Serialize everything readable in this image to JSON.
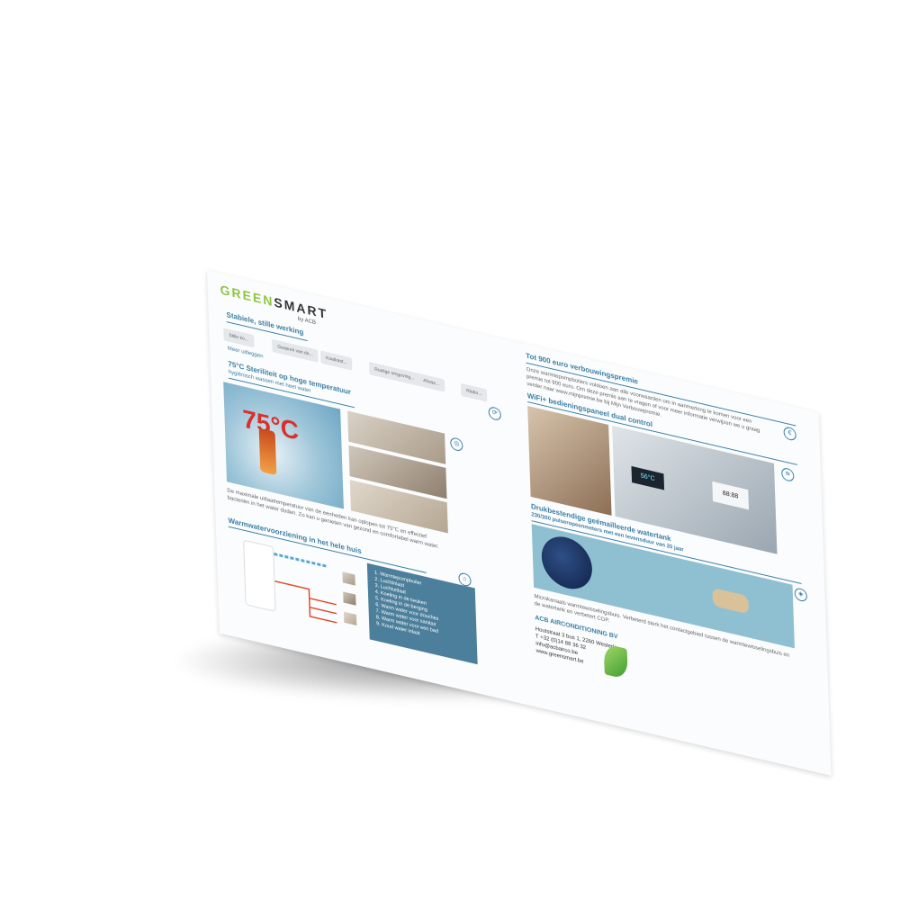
{
  "left_page": {
    "logo_green": "GREEN",
    "logo_dark": "SMART",
    "logo_sub": "by ACB",
    "section1_title": "Stabiele, stille werking",
    "pills": [
      "Stille ko...",
      "Gesprek van de...",
      "Koelkast...",
      "Rustige omgeving...",
      "Afwas...",
      "Radio..."
    ],
    "link_more": "Meer uitleggen",
    "section2_title": "75°C Steriliteit op hoge temperatuur",
    "section2_sub": "hygiënisch wassen met heet water",
    "temp_label": "75°C",
    "section2_body": "De maximale uitlaattemperatuur van de eenheden kan oplopen tot 75°C en effectief bacteriën in het water doden. Zo kan u genieten van gezond en comfortabel warm water.",
    "section3_title": "Warmwatervoorziening in het hele huis",
    "legend": [
      "1. Warmtepompboiler",
      "2. Luchtinlaat",
      "3. Luchtuitlaat",
      "4. Koeling in de keuken",
      "5. Koeling in de berging",
      "6. Warm water voor douches",
      "7. Warm water voor sanitair",
      "8. Warm water voor een bad",
      "9. Koud water inlaat"
    ]
  },
  "right_page": {
    "section1_title": "Tot 900 euro verbouwingspremie",
    "section1_body": "Onze warmtepompboilers voldoen aan alle voorwaarden om in aanmerking te komen voor een premie tot 900 euro. Om deze premie aan te vragen of voor meer informatie verwijzen we u graag verder naar www.mijnpremie.be bij Mijn Verbouwpremie.",
    "section2_title": "WiFi+ bedieningspaneel dual control",
    "display_a": "56°C",
    "display_b": "88:88",
    "section3_title": "Drukbestendige geëmailleerde watertank",
    "section3_sub": "230/300 pulseropeenmeters met een levensduur van 20 jaar",
    "section3_body": "Microkanaals warmtewisselingsbuis. Verbeterd sterk het contactgebied tussen de warmtewisselingsbuis en de watertank en verbetert COP.",
    "company_name": "ACB AIRCONDITIONING BV",
    "address": "Houtstraat 3 bus 1, 2260 Westerlo",
    "phone": "T +32 (0)14 88 36 32",
    "email": "info@acbairco.be",
    "website": "www.greensmart.be"
  },
  "colors": {
    "accent": "#3a7ea5",
    "brand_green": "#8cc63f",
    "legend_bg": "#4c7f9b"
  }
}
